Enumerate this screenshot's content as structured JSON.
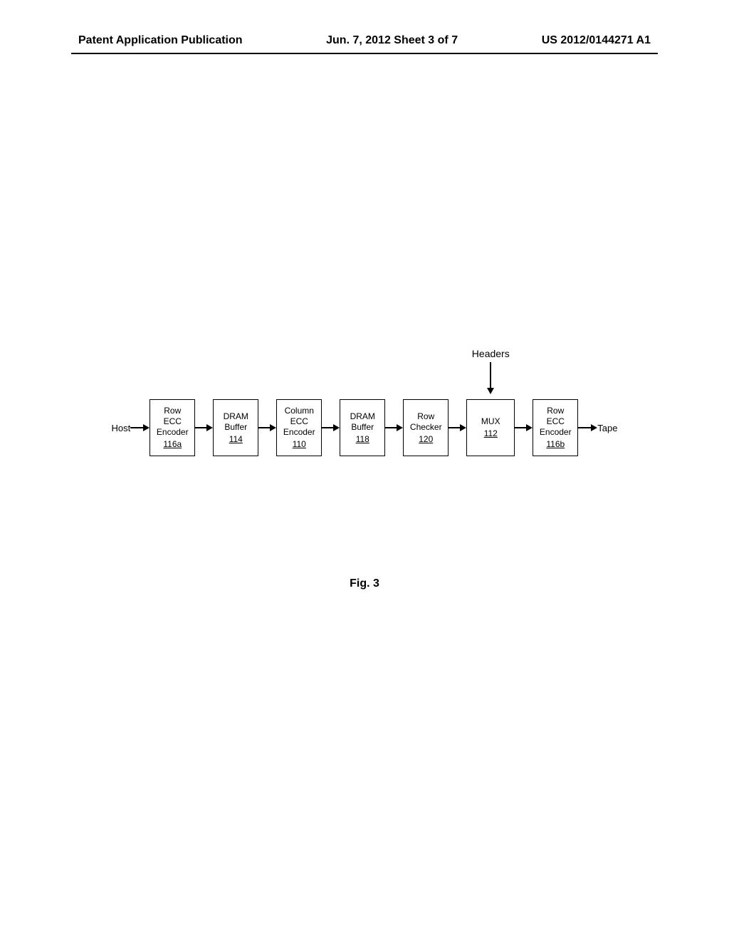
{
  "header": {
    "left": "Patent Application Publication",
    "center": "Jun. 7, 2012  Sheet 3 of 7",
    "right": "US 2012/0144271 A1"
  },
  "diagram": {
    "input_label": "Host",
    "output_label": "Tape",
    "top_input_label": "Headers",
    "blocks": [
      {
        "line1": "Row",
        "line2": "ECC",
        "line3": "Encoder",
        "ref": "116a"
      },
      {
        "line1": "DRAM",
        "line2": "Buffer",
        "line3": "",
        "ref": "114"
      },
      {
        "line1": "Column",
        "line2": "ECC",
        "line3": "Encoder",
        "ref": "110"
      },
      {
        "line1": "DRAM",
        "line2": "Buffer",
        "line3": "",
        "ref": "118"
      },
      {
        "line1": "Row",
        "line2": "Checker",
        "line3": "",
        "ref": "120"
      },
      {
        "line1": "MUX",
        "line2": "",
        "line3": "",
        "ref": "112"
      },
      {
        "line1": "Row",
        "line2": "ECC",
        "line3": "Encoder",
        "ref": "116b"
      }
    ],
    "caption": "Fig. 3"
  }
}
